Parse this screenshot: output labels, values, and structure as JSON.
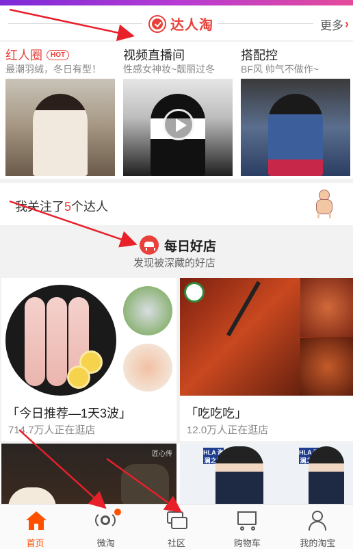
{
  "header": {
    "title": "达人淘",
    "more_label": "更多"
  },
  "cards": [
    {
      "title": "红人圈",
      "tag": "HOT",
      "subtitle": "最潮羽绒，冬日有型！"
    },
    {
      "title": "视频直播间",
      "subtitle": "性感女神妆~靓丽过冬"
    },
    {
      "title": "搭配控",
      "subtitle": "BF风 帅气不做作~"
    }
  ],
  "follow": {
    "prefix": "我关注了",
    "count": "5",
    "suffix": "个达人"
  },
  "daily": {
    "title": "每日好店",
    "subtitle": "发现被深藏的好店"
  },
  "shops": [
    {
      "name": "「今日推荐—1天3波」",
      "meta": "714.7万人正在逛店"
    },
    {
      "name": "「吃吃吃」",
      "meta": "12.0万人正在逛店"
    }
  ],
  "banners": {
    "left_mark": "匠心传",
    "right_brand": "HLA 海澜之家"
  },
  "tabbar": [
    {
      "label": "首页",
      "icon": "home-icon",
      "active": true
    },
    {
      "label": "微淘",
      "icon": "broadcast-icon",
      "badge": true
    },
    {
      "label": "社区",
      "icon": "chat-bubbles-icon"
    },
    {
      "label": "购物车",
      "icon": "cart-icon"
    },
    {
      "label": "我的淘宝",
      "icon": "user-icon"
    }
  ],
  "colors": {
    "accent": "#e8403a",
    "tab_active": "#ff5000"
  }
}
